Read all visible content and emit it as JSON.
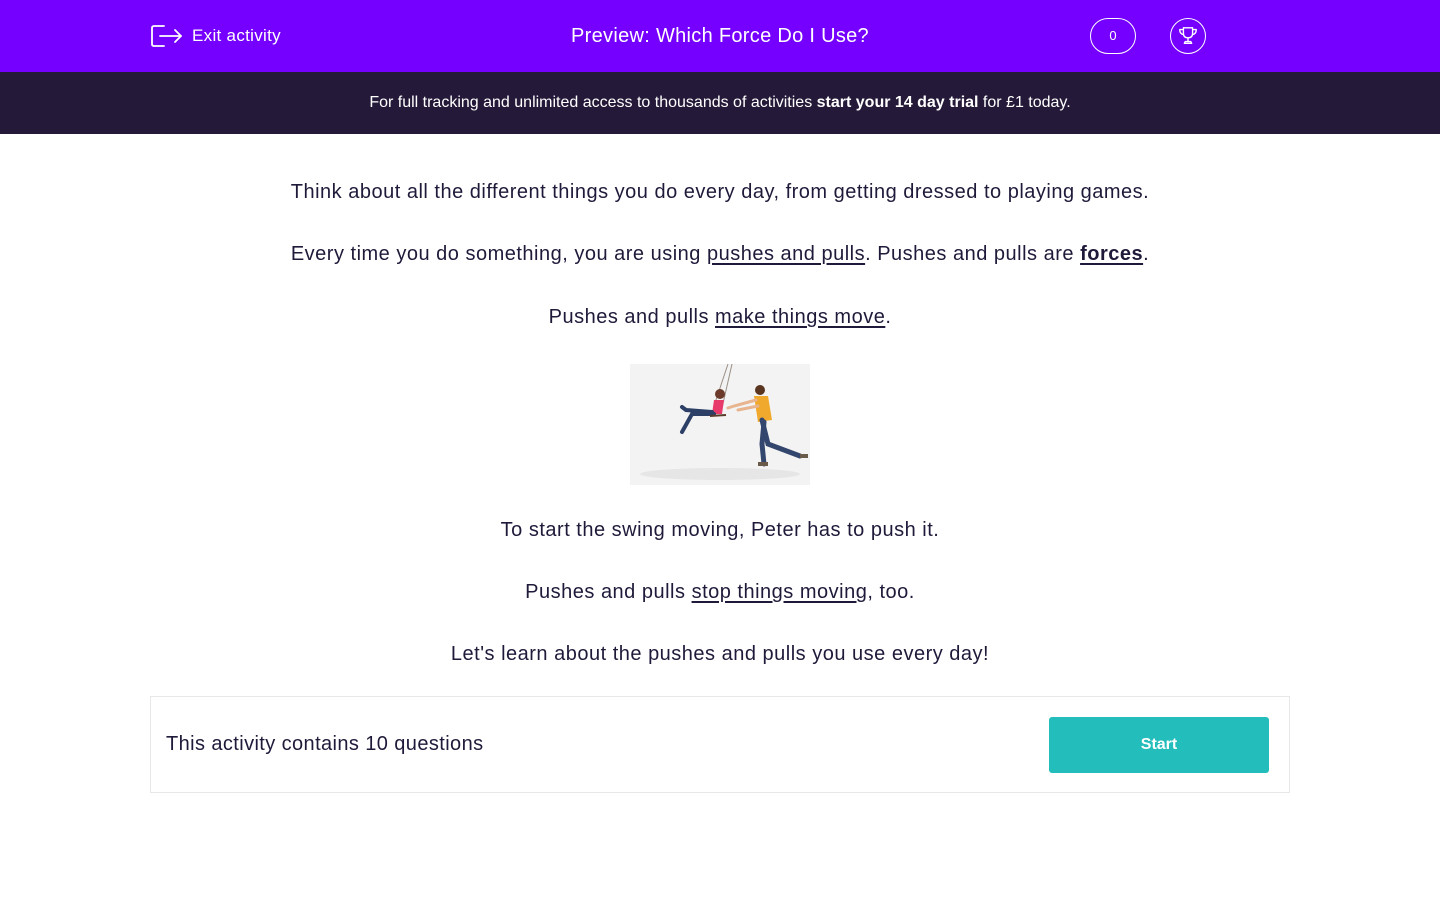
{
  "header": {
    "exit_label": "Exit activity",
    "title": "Preview: Which Force Do I Use?",
    "score": "0"
  },
  "banner": {
    "prefix": "For full tracking and unlimited access to thousands of activities ",
    "link": "start your 14 day trial",
    "suffix": " for £1 today."
  },
  "intro": {
    "p1": "Think about all the different things you do every day, from getting dressed to playing games.",
    "p2_a": "Every time you do something, you are using ",
    "p2_link1": "pushes and pulls",
    "p2_b": ". Pushes and pulls are ",
    "p2_link2": "forces",
    "p2_c": ".",
    "p3_a": "Pushes and pulls ",
    "p3_link": "make things move",
    "p3_b": ".",
    "p4": "To start the swing moving, Peter has to push it.",
    "p5_a": "Pushes and pulls ",
    "p5_link": "stop things moving",
    "p5_b": ", too.",
    "p6": "Let's learn about the pushes and pulls you use every day!"
  },
  "footer": {
    "question_count_text": "This activity contains 10 questions",
    "start_label": "Start"
  },
  "colors": {
    "header_bg": "#7500ff",
    "banner_bg": "#241938",
    "start_button": "#23bdbb",
    "text": "#1f1a3a"
  }
}
